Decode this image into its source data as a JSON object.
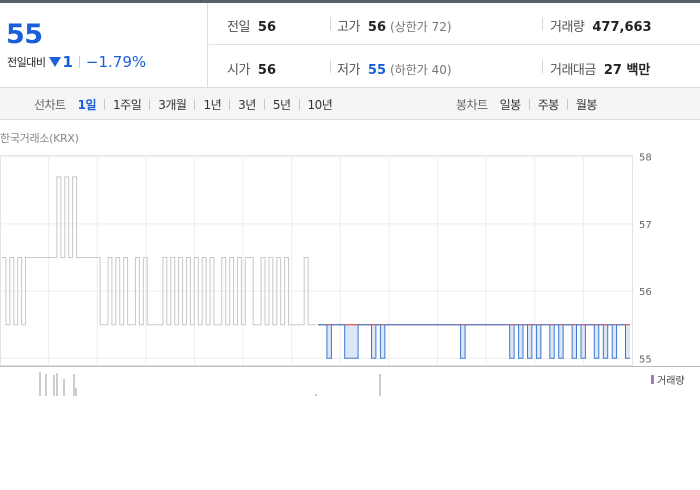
{
  "summary": {
    "price": "55",
    "change_label": "전일대비",
    "change_value": "1",
    "change_rate": "−1.79%",
    "prev_close_label": "전일",
    "prev_close": "56",
    "high_label": "고가",
    "high": "56",
    "upper_limit": "(상한가 72)",
    "volume_label": "거래량",
    "volume": "477,663",
    "open_label": "시가",
    "open": "56",
    "low_label": "저가",
    "low": "55",
    "lower_limit": "(하한가 40)",
    "amount_label": "거래대금",
    "amount": "27 백만"
  },
  "tabs": {
    "line_label": "선차트",
    "line_tabs": [
      "1일",
      "1주일",
      "3개월",
      "1년",
      "3년",
      "5년",
      "10년"
    ],
    "candle_label": "봉차트",
    "candle_tabs": [
      "일봉",
      "주봉",
      "월봉"
    ]
  },
  "chart": {
    "exchange": "한국거래소(KRX)",
    "y_ticks": [
      "58",
      "57",
      "56",
      "55"
    ],
    "volume_legend": "거래량"
  },
  "colors": {
    "accent_blue": "#1a5ed8",
    "prev_day_line": "#c8c8c8",
    "today_line": "#3a78d0",
    "prev_close_line": "#d23232",
    "volume_bar": "#9a7bc8"
  },
  "chart_data": {
    "type": "line",
    "ylim": [
      54.9,
      58.1
    ],
    "y_ticks": [
      58,
      57,
      56,
      55
    ],
    "reference_line": 55.5,
    "series": [
      {
        "values": [
          56.5,
          55.5,
          56.5,
          55.5,
          56.5,
          55.5,
          56.5,
          56.5,
          56.5,
          56.5,
          56.5,
          56.5,
          56.5,
          56.5,
          57.7,
          56.5,
          57.7,
          56.5,
          57.7,
          56.5,
          56.5,
          56.5,
          56.5,
          56.5,
          56.5,
          55.5,
          55.5,
          56.5,
          55.5,
          56.5,
          55.5,
          56.5,
          55.5,
          55.5,
          56.5,
          55.5,
          56.5,
          55.5,
          55.5,
          55.5,
          55.5,
          56.5,
          55.5,
          56.5,
          55.5,
          56.5,
          55.5,
          56.5,
          55.5,
          56.5,
          55.5,
          56.5,
          55.5,
          56.5,
          55.5,
          55.5,
          56.5,
          55.5,
          56.5,
          55.5,
          56.5,
          55.5,
          56.5,
          56.5,
          55.5,
          55.5,
          56.5,
          55.5,
          56.5,
          55.5,
          56.5,
          55.5,
          56.5,
          55.5,
          55.5,
          55.5,
          55.5,
          56.5,
          55.5,
          55.5
        ]
      },
      {
        "values": [
          55.5,
          55.5,
          55.0,
          55.5,
          55.5,
          55.5,
          55.0,
          55.0,
          55.0,
          55.5,
          55.5,
          55.5,
          55.0,
          55.5,
          55.0,
          55.5,
          55.5,
          55.5,
          55.5,
          55.5,
          55.5,
          55.5,
          55.5,
          55.5,
          55.5,
          55.5,
          55.5,
          55.5,
          55.5,
          55.5,
          55.5,
          55.5,
          55.0,
          55.5,
          55.5,
          55.5,
          55.5,
          55.5,
          55.5,
          55.5,
          55.5,
          55.5,
          55.5,
          55.0,
          55.5,
          55.0,
          55.5,
          55.0,
          55.5,
          55.0,
          55.5,
          55.5,
          55.0,
          55.5,
          55.0,
          55.5,
          55.5,
          55.0,
          55.5,
          55.0,
          55.5,
          55.5,
          55.0,
          55.5,
          55.0,
          55.5,
          55.0,
          55.5,
          55.5,
          55.0
        ]
      }
    ]
  }
}
